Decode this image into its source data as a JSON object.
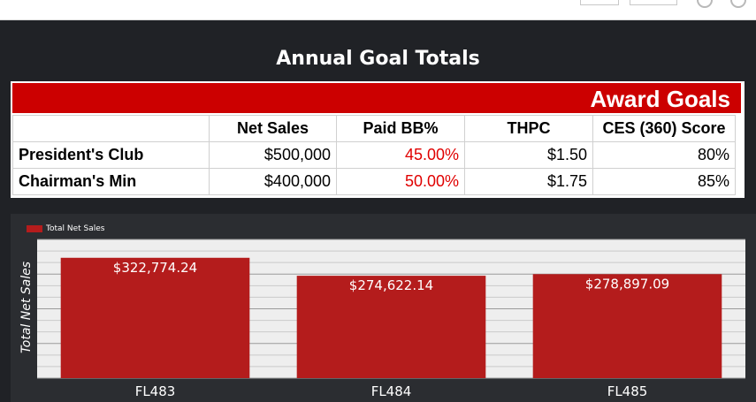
{
  "page_title": "Annual Goal Totals",
  "goals_table": {
    "banner": "Award Goals",
    "headers": [
      "",
      "Net Sales",
      "Paid BB%",
      "THPC",
      "CES (360) Score"
    ],
    "rows": [
      {
        "label": "President's Club",
        "net_sales": "$500,000",
        "paid_bb": "45.00%",
        "thpc": "$1.50",
        "ces": "80%"
      },
      {
        "label": "Chairman's Min",
        "net_sales": "$400,000",
        "paid_bb": "50.00%",
        "thpc": "$1.75",
        "ces": "85%"
      }
    ]
  },
  "chart_data": {
    "type": "bar",
    "categories": [
      "FL483",
      "FL484",
      "FL485"
    ],
    "series": [
      {
        "name": "Total Net Sales",
        "values": [
          322774.24,
          274622.14,
          278897.09
        ],
        "labels": [
          "$322,774.24",
          "$274,622.14",
          "$278,897.09"
        ]
      }
    ],
    "ylabel": "Total Net Sales",
    "xlabel": "",
    "legend": "top-left",
    "grid": true,
    "bar_color": "#b41c1c",
    "ylim": [
      0,
      372000
    ]
  },
  "colors": {
    "banner": "#cc0000",
    "bar": "#b41c1c",
    "percent_text": "#e00000",
    "background": "#202226"
  }
}
